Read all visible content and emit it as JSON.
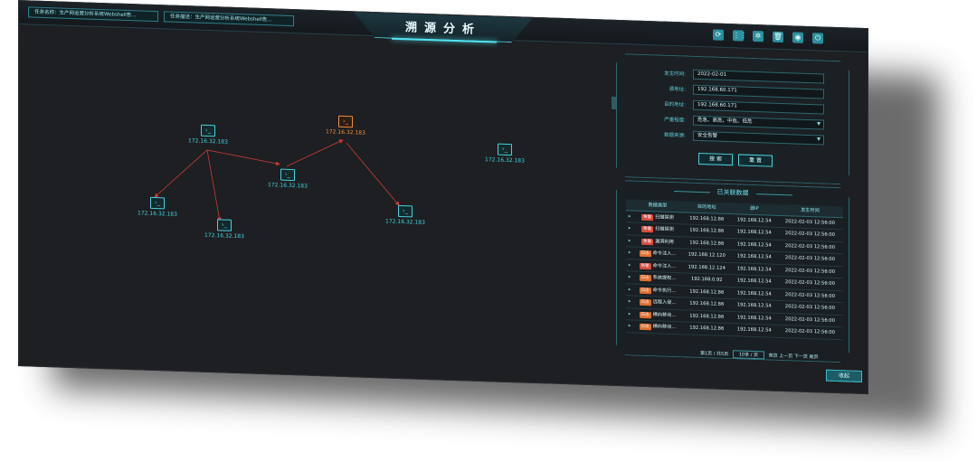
{
  "header": {
    "title": "溯源分析",
    "task_tabs": [
      "任务名称：生产网运营分析系统Webshell告...",
      "任务描述：生产网运营分析系统Webshell告..."
    ],
    "tools": [
      {
        "name": "refresh-icon",
        "glyph": "⟳"
      },
      {
        "name": "grid-icon",
        "glyph": "⋮⋮"
      },
      {
        "name": "network-icon",
        "glyph": "✲"
      },
      {
        "name": "trash-icon",
        "glyph": "🗑"
      },
      {
        "name": "eye-icon",
        "glyph": "◉"
      },
      {
        "name": "power-icon",
        "glyph": "⏻"
      }
    ]
  },
  "graph": {
    "nodes": [
      {
        "label": "172.16.32.183",
        "color": "cyan"
      },
      {
        "label": "172.16.32.183",
        "color": "orange"
      },
      {
        "label": "172.16.32.183",
        "color": "cyan"
      },
      {
        "label": "172.16.32.183",
        "color": "cyan"
      },
      {
        "label": "172.16.32.183",
        "color": "cyan"
      },
      {
        "label": "172.16.32.183",
        "color": "cyan"
      },
      {
        "label": "172.16.32.183",
        "color": "cyan"
      }
    ],
    "edge_color": "#cc3b38"
  },
  "filter": {
    "fields": [
      {
        "label": "发生时间:",
        "value": "2022-02-01",
        "select": false
      },
      {
        "label": "源地址:",
        "value": "192.168.60.171",
        "select": false
      },
      {
        "label": "目的地址:",
        "value": "192.168.60.171",
        "select": false
      },
      {
        "label": "严重程度:",
        "value": "危急、高危、中危、低危",
        "select": true
      },
      {
        "label": "数据来源:",
        "value": "安全告警",
        "select": true
      }
    ],
    "search_label": "搜 索",
    "reset_label": "重 置"
  },
  "related": {
    "title": "已关联数据",
    "columns": [
      "",
      "数据类型",
      "目的地址",
      "源IP",
      "发生时间"
    ],
    "rows": [
      [
        "▸",
        "告警",
        "扫描探测",
        "192.168.12.86",
        "192.168.12.54",
        "2022-02-03 12:56:00"
      ],
      [
        "▸",
        "告警",
        "扫描探测",
        "192.168.12.86",
        "192.168.12.54",
        "2022-02-03 12:56:00"
      ],
      [
        "▸",
        "告警",
        "漏洞利用",
        "192.168.12.86",
        "192.168.12.54",
        "2022-02-03 12:56:00"
      ],
      [
        "▸",
        "日志",
        "命令注入...",
        "192.168.12.120",
        "192.168.12.54",
        "2022-02-03 12:56:00"
      ],
      [
        "▸",
        "告警",
        "命令注入...",
        "192.168.12.124",
        "192.168.12.54",
        "2022-02-03 12:56:00"
      ],
      [
        "▸",
        "日志",
        "系统提权...",
        "192.168.0.92",
        "192.168.12.54",
        "2022-02-03 12:56:00"
      ],
      [
        "▸",
        "日志",
        "命令执行...",
        "192.168.12.86",
        "192.168.12.54",
        "2022-02-03 12:56:00"
      ],
      [
        "▸",
        "日志",
        "远程入侵...",
        "192.168.12.86",
        "192.168.12.54",
        "2022-02-03 12:56:00"
      ],
      [
        "▸",
        "日志",
        "横向移动...",
        "192.168.12.86",
        "192.168.12.54",
        "2022-02-03 12:56:00"
      ],
      [
        "▸",
        "日志",
        "横向移动...",
        "192.168.12.86",
        "192.168.12.54",
        "2022-02-03 12:56:00"
      ]
    ],
    "pager": {
      "summary": "第1页 / 共5页",
      "page_size": "10条 / 页",
      "first": "首页",
      "prev": "上一页",
      "next": "下一页",
      "last": "尾页"
    }
  },
  "fold_label": "收起"
}
